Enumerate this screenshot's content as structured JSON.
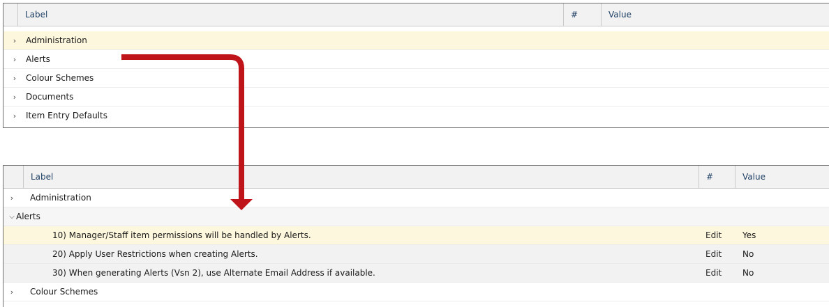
{
  "columns": {
    "label": "Label",
    "num": "#",
    "value": "Value"
  },
  "top_panel": {
    "rows": [
      {
        "label": "Administration"
      },
      {
        "label": "Alerts"
      },
      {
        "label": "Colour Schemes"
      },
      {
        "label": "Documents"
      },
      {
        "label": "Item Entry Defaults"
      }
    ]
  },
  "bottom_panel": {
    "administration": {
      "label": "Administration"
    },
    "alerts": {
      "label": "Alerts"
    },
    "alert_items": [
      {
        "label": "10) Manager/Staff item permissions will be handled by Alerts.",
        "action": "Edit",
        "value": "Yes"
      },
      {
        "label": "20) Apply User Restrictions when creating Alerts.",
        "action": "Edit",
        "value": "No"
      },
      {
        "label": "30) When generating Alerts (Vsn 2), use Alternate Email Address if available.",
        "action": "Edit",
        "value": "No"
      }
    ],
    "colour_schemes": {
      "label": "Colour Schemes"
    }
  },
  "icons": {
    "collapsed": "chevron-right-icon",
    "expanded": "chevron-down-icon",
    "annotation": "red-arrow"
  },
  "colors": {
    "highlight_row": "#fdf7dd",
    "header_text": "#1f3f64",
    "arrow": "#c0141b"
  }
}
